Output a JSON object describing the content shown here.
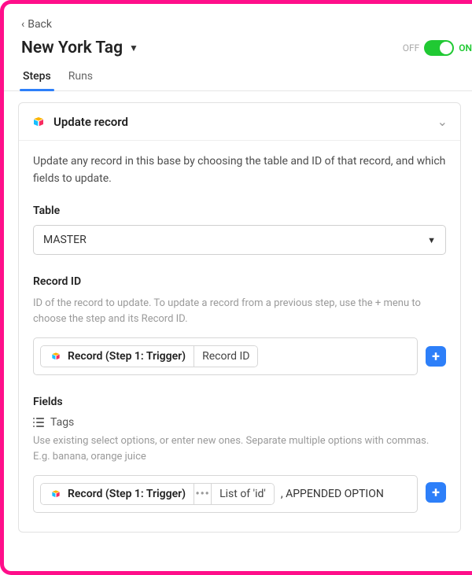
{
  "back": {
    "label": "Back"
  },
  "header": {
    "title": "New York Tag",
    "off_label": "OFF",
    "on_label": "ON"
  },
  "tabs": [
    {
      "label": "Steps",
      "active": true
    },
    {
      "label": "Runs",
      "active": false
    }
  ],
  "step": {
    "title": "Update record",
    "description": "Update any record in this base by choosing the table and ID of that record, and which fields to update.",
    "table": {
      "label": "Table",
      "value": "MASTER"
    },
    "record_id": {
      "label": "Record ID",
      "help": "ID of the record to update. To update a record from a previous step, use the + menu to choose the step and its Record ID.",
      "token_source": "Record (Step 1: Trigger)",
      "token_field": "Record ID"
    },
    "fields": {
      "label": "Fields",
      "tags": {
        "name": "Tags",
        "help": "Use existing select options, or enter new ones. Separate multiple options with commas. E.g. banana, orange juice",
        "token_source": "Record (Step 1: Trigger)",
        "token_menu": "•••",
        "token_field": "List of 'id'",
        "suffix": ", APPENDED OPTION"
      }
    }
  }
}
